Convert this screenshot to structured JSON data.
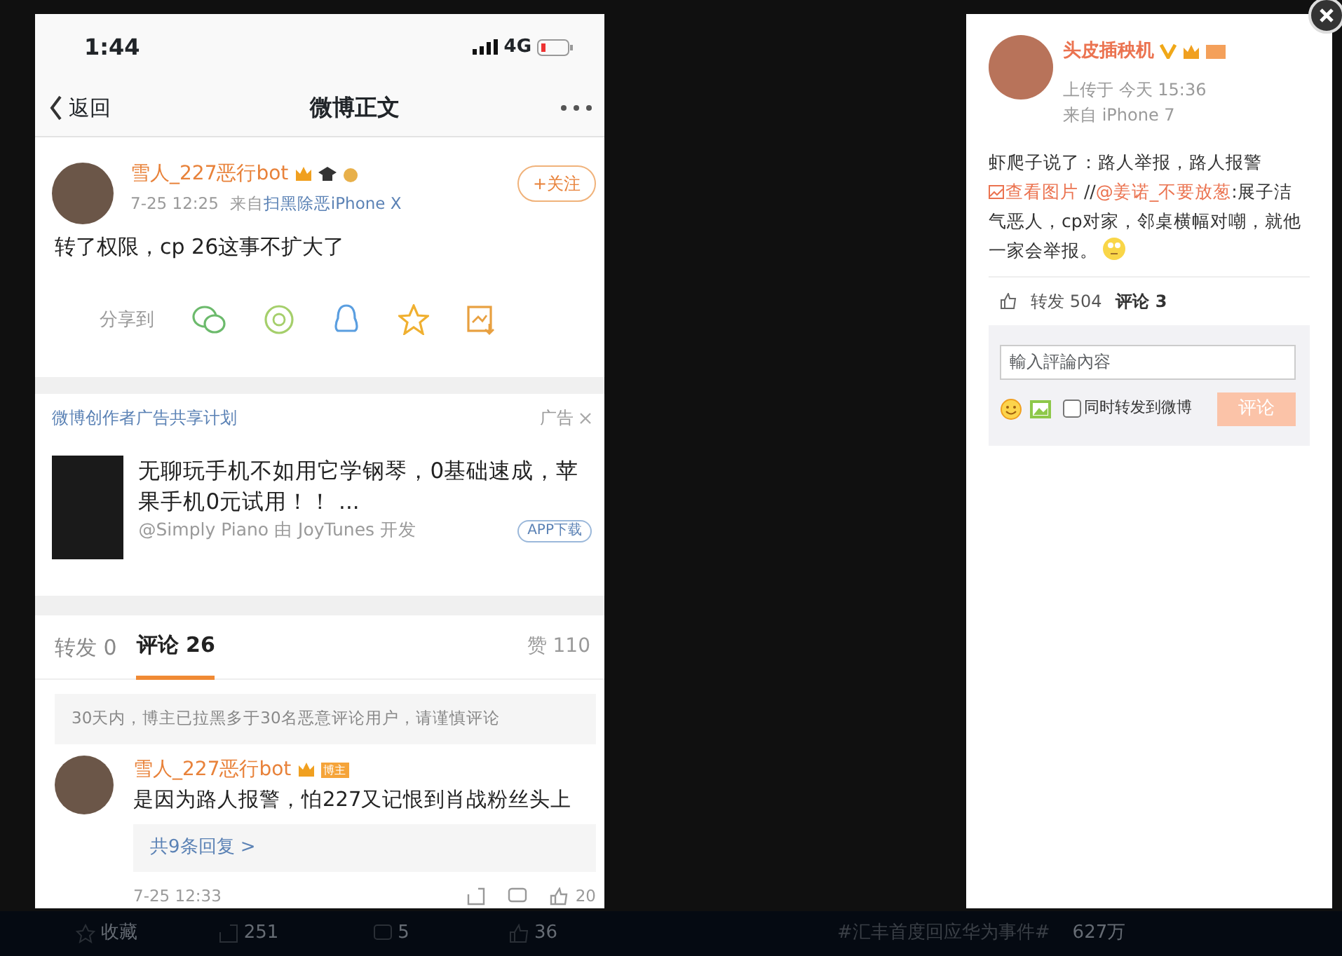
{
  "phone": {
    "status_bar": {
      "time": "1:44",
      "network": "4G"
    },
    "nav": {
      "back": "返回",
      "title": "微博正文"
    },
    "post": {
      "author": "雪人_227恶行bot",
      "time": "7-25 12:25",
      "source_prefix": "来自",
      "source": "扫黑除恶iPhone X",
      "follow": "+关注",
      "text": "转了权限，cp 26这事不扩大了",
      "share_label": "分享到"
    },
    "ad": {
      "sponsor": "微博创作者广告共享计划",
      "tag": "广告",
      "title": "无聊玩手机不如用它学钢琴，0基础速成，苹果手机0元试用！！ ...",
      "byline": "@Simply Piano 由 JoyTunes 开发",
      "button": "APP下载"
    },
    "tabs": [
      {
        "label": "转发 0",
        "selected": false
      },
      {
        "label": "评论 26",
        "selected": true
      }
    ],
    "likes": "赞 110",
    "notice": "30天内，博主已拉黑多于30名恶意评论用户，请谨慎评论",
    "comment": {
      "author": "雪人_227恶行bot",
      "badge": "博主",
      "text": "是因为路人报警，怕227又记恨到肖战粉丝头上",
      "replies": "共9条回复 >",
      "time": "7-25 12:33",
      "likes": "20"
    }
  },
  "panel": {
    "author": "头皮插秧机",
    "upload": "上传于 今天 15:36",
    "source": "来自 iPhone 7",
    "text": [
      {
        "kind": "text",
        "text": "虾爬子说了：路人举报，路人报警 "
      },
      {
        "kind": "image_link",
        "text": "查看图片"
      },
      {
        "kind": "text",
        "text": " //"
      },
      {
        "kind": "link",
        "text": "@姜诺_不要放葱"
      },
      {
        "kind": "text",
        "text": ":展子洁气恶人，cp对家，邻桌横幅对嘲，就他一家会举报。"
      }
    ],
    "reposts": "转发 504",
    "comments": "评论 3",
    "comment_box": {
      "placeholder": "輸入評論內容",
      "also_repost": "同时转发到微博",
      "also_repost_checked": false,
      "submit": "评论",
      "submit_disabled": true
    }
  },
  "background": {
    "actions": [
      {
        "kind": "star",
        "label": "收藏"
      },
      {
        "kind": "share",
        "label": "251"
      },
      {
        "kind": "comment",
        "label": "5"
      },
      {
        "kind": "like",
        "label": "36"
      }
    ],
    "topic": "#汇丰首度回应华为事件#",
    "topic_count": "627万"
  }
}
